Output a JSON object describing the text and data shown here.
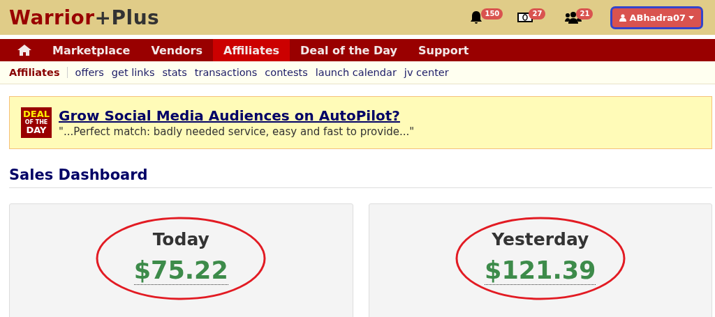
{
  "logo": {
    "first": "Warrior",
    "second": "+Plus"
  },
  "notifications": [
    {
      "kind": "bell",
      "count": "150"
    },
    {
      "kind": "money",
      "count": "27"
    },
    {
      "kind": "people",
      "count": "21"
    }
  ],
  "user_menu": {
    "label": "ABhadra07"
  },
  "nav": [
    {
      "label": "Marketplace",
      "selected": false
    },
    {
      "label": "Vendors",
      "selected": false
    },
    {
      "label": "Affiliates",
      "selected": true
    },
    {
      "label": "Deal of the Day",
      "selected": false
    },
    {
      "label": "Support",
      "selected": false
    }
  ],
  "subnav": {
    "section": "Affiliates",
    "links": [
      "offers",
      "get links",
      "stats",
      "transactions",
      "contests",
      "launch calendar",
      "jv center"
    ]
  },
  "deal": {
    "badge": [
      "DEAL",
      "OF THE",
      "DAY"
    ],
    "title": "Grow Social Media Audiences on AutoPilot?",
    "quote": "\"...Perfect match: badly needed service, easy and fast to provide...\""
  },
  "dashboard": {
    "title": "Sales Dashboard",
    "cards": [
      {
        "label": "Today",
        "amount": "$75.22",
        "circled": true
      },
      {
        "label": "Yesterday",
        "amount": "$121.39",
        "circled": true
      }
    ]
  }
}
